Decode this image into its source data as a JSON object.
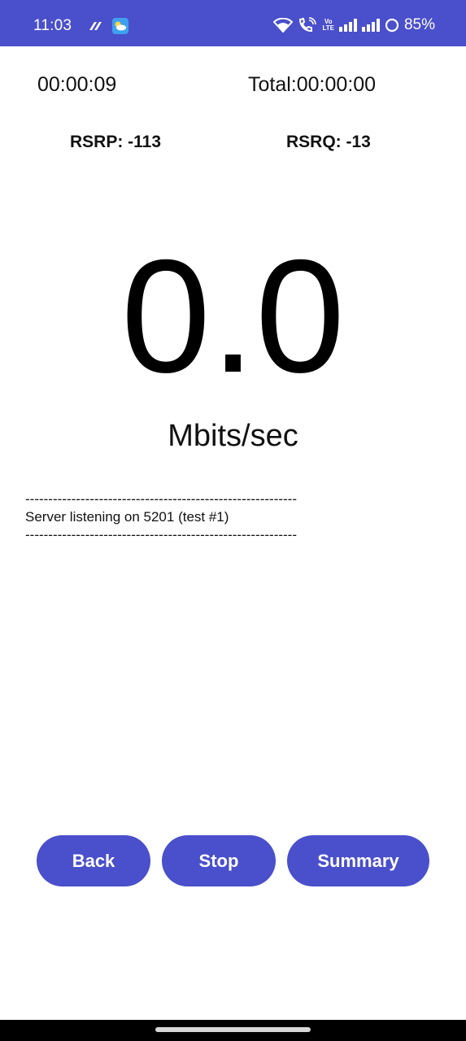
{
  "status_bar": {
    "time": "11:03",
    "battery": "85%",
    "background": "#4a4fcb",
    "volte_top": "Vo",
    "volte_bottom": "LTE"
  },
  "test": {
    "elapsed": "00:00:09",
    "total": "Total:00:00:00"
  },
  "signal": {
    "rsrp": "RSRP: -113",
    "rsrq": "RSRQ: -13"
  },
  "speed": {
    "value": "0.0",
    "unit": "Mbits/sec"
  },
  "log": {
    "text": "-----------------------------------------------------------\nServer listening on 5201 (test #1)\n-----------------------------------------------------------"
  },
  "buttons": {
    "back": "Back",
    "stop": "Stop",
    "summary": "Summary",
    "color": "#4a4fcb"
  }
}
